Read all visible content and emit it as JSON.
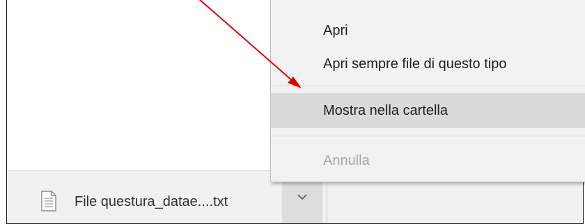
{
  "download_shelf": {
    "file_name": "File questura_datae....txt",
    "file_icon": "text-file-icon",
    "dropdown_icon": "chevron-down-icon"
  },
  "context_menu": {
    "items": [
      {
        "label": "Apri",
        "enabled": true
      },
      {
        "label": "Apri sempre file di questo tipo",
        "enabled": true
      },
      {
        "label": "Mostra nella cartella",
        "enabled": true,
        "highlighted": true
      },
      {
        "label": "Annulla",
        "enabled": false
      }
    ]
  },
  "annotation": {
    "type": "arrow",
    "color": "#e00000"
  },
  "colors": {
    "menu_background": "#f2f2f2",
    "menu_highlight": "#dadada",
    "disabled_text": "#a6a6a6",
    "shelf_background": "#f1f1f1"
  }
}
